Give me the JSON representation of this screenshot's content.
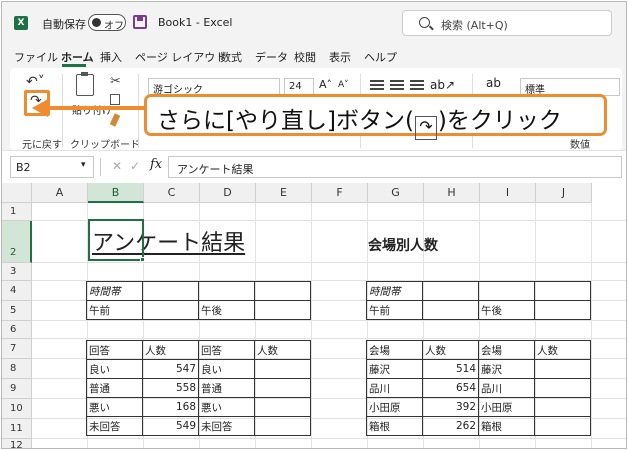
{
  "titlebar": {
    "autosave_label": "自動保存",
    "toggle_state": "オフ",
    "doc_title": "Book1 - Excel",
    "search_placeholder": "検索 (Alt+Q)"
  },
  "menu": {
    "tabs": [
      "ファイル",
      "ホーム",
      "挿入",
      "ページ レイアウト",
      "数式",
      "データ",
      "校閲",
      "表示",
      "ヘルプ"
    ],
    "active": "ホーム"
  },
  "ribbon": {
    "undo_group": "元に戻す",
    "clipboard_group": "クリップボード",
    "paste_label": "貼り付け",
    "font_name": "游ゴシック",
    "font_size": "24",
    "number_format": "標準",
    "number_group": "数値"
  },
  "callout": {
    "text_before": "さらに[やり直し]ボタン(",
    "text_after": ")をクリック"
  },
  "formula_bar": {
    "name_box": "B2",
    "fx": "fx",
    "content": "アンケート結果"
  },
  "grid": {
    "columns": [
      "A",
      "B",
      "C",
      "D",
      "E",
      "F",
      "G",
      "H",
      "I",
      "J"
    ],
    "rows": [
      "1",
      "2",
      "3",
      "4",
      "5",
      "6",
      "7",
      "8",
      "9",
      "10",
      "11",
      "12"
    ],
    "selected_column": "B",
    "selected_row": "2"
  },
  "sheet": {
    "title": "アンケート結果",
    "venue_title": "会場別人数",
    "left_time_header": "時間帯",
    "left_time": [
      "午前",
      "午後"
    ],
    "left_headers": [
      "回答",
      "人数",
      "回答",
      "人数"
    ],
    "left_rows": [
      [
        "良い",
        "547",
        "良い",
        ""
      ],
      [
        "普通",
        "558",
        "普通",
        ""
      ],
      [
        "悪い",
        "168",
        "悪い",
        ""
      ],
      [
        "未回答",
        "549",
        "未回答",
        ""
      ]
    ],
    "right_time_header": "時間帯",
    "right_time": [
      "午前",
      "午後"
    ],
    "right_headers": [
      "会場",
      "人数",
      "会場",
      "人数"
    ],
    "right_rows": [
      [
        "藤沢",
        "514",
        "藤沢",
        ""
      ],
      [
        "品川",
        "654",
        "品川",
        ""
      ],
      [
        "小田原",
        "392",
        "小田原",
        ""
      ],
      [
        "箱根",
        "262",
        "箱根",
        ""
      ]
    ]
  }
}
